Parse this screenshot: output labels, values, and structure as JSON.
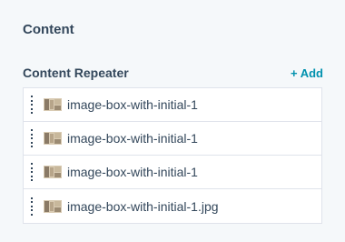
{
  "section": {
    "title": "Content"
  },
  "repeater": {
    "label": "Content Repeater",
    "add_label": "+ Add",
    "items": [
      {
        "label": "image-box-with-initial-1",
        "icon": "image-thumbnail-icon"
      },
      {
        "label": "image-box-with-initial-1",
        "icon": "image-thumbnail-icon"
      },
      {
        "label": "image-box-with-initial-1",
        "icon": "image-thumbnail-icon"
      },
      {
        "label": "image-box-with-initial-1.jpg",
        "icon": "image-thumbnail-icon"
      }
    ]
  },
  "colors": {
    "text": "#33475b",
    "accent": "#0091ae",
    "border": "#dfe3eb",
    "background": "#f5f8fa"
  }
}
